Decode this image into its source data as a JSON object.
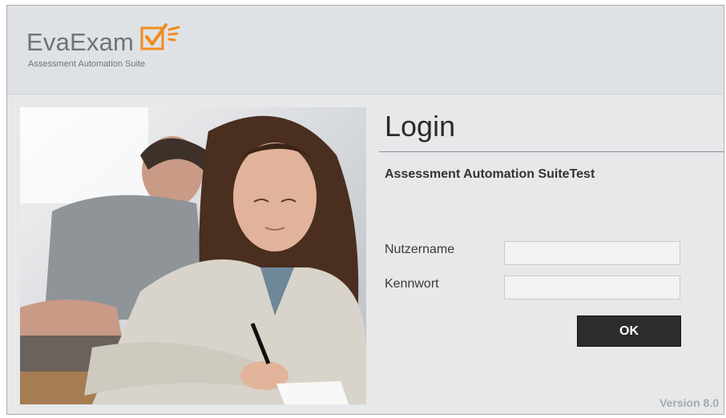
{
  "logo": {
    "name": "EvaExam",
    "tagline": "Assessment Automation Suite"
  },
  "login": {
    "title": "Login",
    "subtitle": "Assessment Automation SuiteTest",
    "username_label": "Nutzername",
    "password_label": "Kennwort",
    "username_value": "",
    "password_value": "",
    "ok_label": "OK"
  },
  "footer": {
    "version": "Version 8.0"
  },
  "colors": {
    "logo_accent": "#f28b1e",
    "button_bg": "#2c2c2c",
    "background": "#e6e8ea"
  }
}
